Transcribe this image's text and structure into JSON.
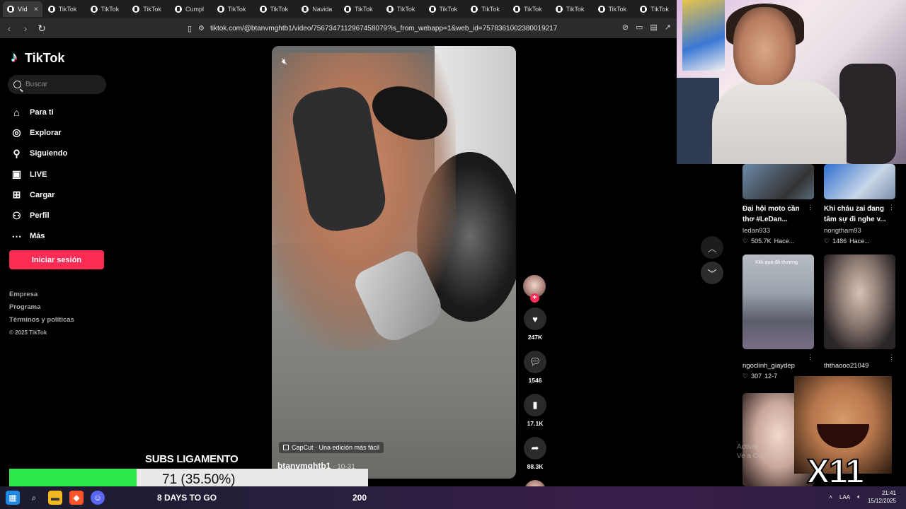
{
  "browser": {
    "tabs": [
      {
        "label": "Víd",
        "active": true
      },
      {
        "label": "TikTok"
      },
      {
        "label": "TikTok"
      },
      {
        "label": "TikTok"
      },
      {
        "label": "Cumpl"
      },
      {
        "label": "TikTok"
      },
      {
        "label": "TikTok"
      },
      {
        "label": "Navida"
      },
      {
        "label": "TikTok"
      },
      {
        "label": "TikTok"
      },
      {
        "label": "TikTok"
      },
      {
        "label": "TikTok"
      },
      {
        "label": "TikTok"
      },
      {
        "label": "TikTok"
      },
      {
        "label": "TikTok"
      },
      {
        "label": "TikTok"
      }
    ],
    "url": "tiktok.com/@btanvmghtb1/video/7567347112967458079?is_from_webapp=1&web_id=7578361002380019217"
  },
  "sidebar": {
    "logo": "TikTok",
    "search_placeholder": "Buscar",
    "nav": [
      {
        "label": "Para ti",
        "icon": "home-icon"
      },
      {
        "label": "Explorar",
        "icon": "compass-icon"
      },
      {
        "label": "Siguiendo",
        "icon": "following-icon"
      },
      {
        "label": "LIVE",
        "icon": "live-icon"
      },
      {
        "label": "Cargar",
        "icon": "upload-icon"
      },
      {
        "label": "Perfil",
        "icon": "profile-icon"
      },
      {
        "label": "Más",
        "icon": "more-icon"
      }
    ],
    "login": "Iniciar sesión",
    "footer": [
      "Empresa",
      "Programa",
      "Términos y políticas"
    ],
    "copyright": "© 2025 TikTok"
  },
  "video": {
    "capcut": "CapCut · Una edición más fácil",
    "author": "btanvmghtb1",
    "date": " · 10-31",
    "likes": "247K",
    "comments": "1546",
    "saves": "17.1K",
    "shares": "88.3K"
  },
  "grid": [
    {
      "title": "Đại hội moto cần thơ #LeDan...",
      "user": "ledan933",
      "views": "505.7K",
      "time": "Hace..."
    },
    {
      "title": "Khi cháu zai đang tâm sự đi nghe v...",
      "user": "nongtham93",
      "views": "1486",
      "time": "Hace..."
    },
    {
      "title": "",
      "user": "ngoclinh_giaydep",
      "views": "307",
      "time": "12-7",
      "overlay": "Kkk quá đã thương"
    },
    {
      "title": "",
      "user": "ththaooo21049",
      "views": "",
      "time": ""
    }
  ],
  "overlay": {
    "subs_title": "SUBS LIGAMENTO",
    "subs_count": "71 (35.50%)",
    "subs_progress": 0.355,
    "days_to_go": "8 DAYS TO GO",
    "goal": "200",
    "meme_text": "X11",
    "watermark_1": "Activar",
    "watermark_2": "Ve a Conf"
  },
  "taskbar": {
    "lang": "LAA",
    "time": "21:41",
    "date": "15/12/2025"
  },
  "colors": {
    "brand": "#fe2c55",
    "progress": "#2ee84a"
  }
}
